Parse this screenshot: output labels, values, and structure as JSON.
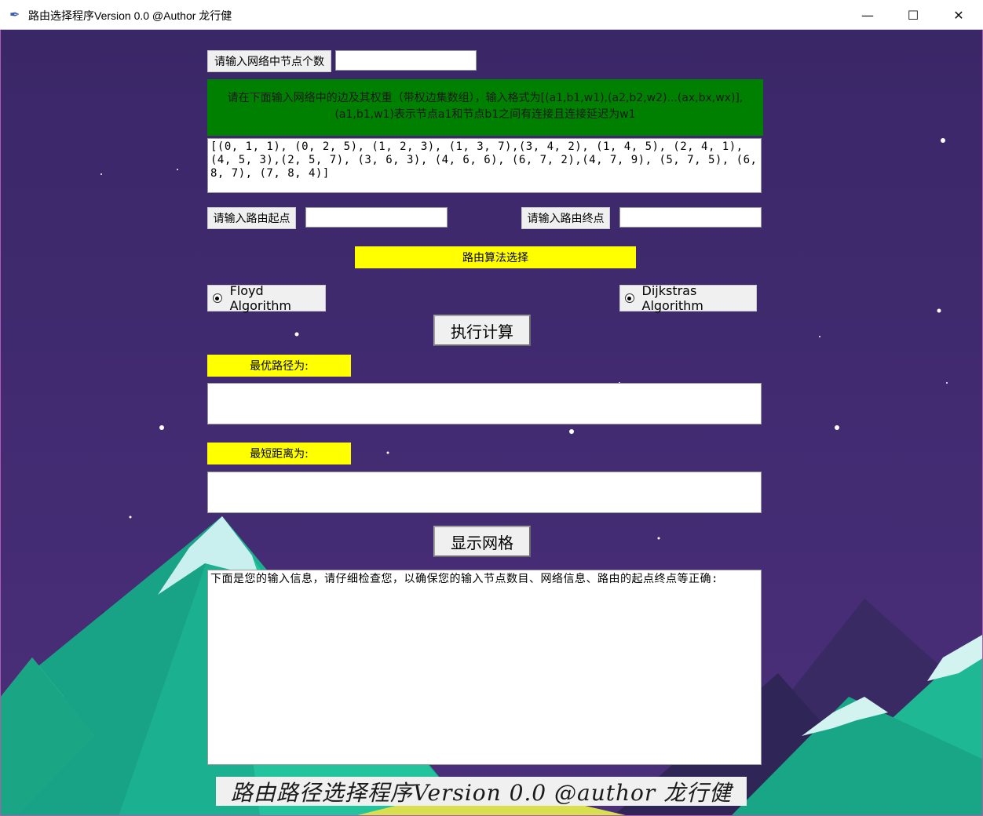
{
  "window": {
    "title": "路由选择程序Version 0.0 @Author 龙行健",
    "minimize": "—",
    "maximize": "☐",
    "close": "✕"
  },
  "form": {
    "node_count_label": "请输入网络中节点个数",
    "node_count_value": "",
    "edges_instruction": "请在下面输入网络中的边及其权重（带权边集数组），输入格式为[(a1,b1,w1),(a2,b2,w2)...(ax,bx,wx)],(a1,b1,w1)表示节点a1和节点b1之间有连接且连接延迟为w1",
    "edges_value": "[(0, 1, 1), (0, 2, 5), (1, 2, 3), (1, 3, 7),(3, 4, 2), (1, 4, 5), (2, 4, 1), (4, 5, 3),(2, 5, 7), (3, 6, 3), (4, 6, 6), (6, 7, 2),(4, 7, 9), (5, 7, 5), (6, 8, 7), (7, 8, 4)]",
    "start_label": "请输入路由起点",
    "start_value": "",
    "end_label": "请输入路由终点",
    "end_value": "",
    "algorithm_header": "路由算法选择",
    "floyd_label": "Floyd Algorithm",
    "dijkstra_label": "Dijkstras Algorithm",
    "compute_button": "执行计算",
    "best_path_label": "最优路径为:",
    "best_path_value": "",
    "shortest_distance_label": "最短距离为:",
    "shortest_distance_value": "",
    "show_grid_button": "显示网格",
    "info_text": "下面是您的输入信息，请仔细检查您，以确保您的输入节点数目、网络信息、路由的起点终点等正确:",
    "footer_text": "路由路径选择程序Version 0.0 @author 龙行健"
  },
  "colors": {
    "background": "#3b2a6b",
    "green_panel": "#008000",
    "yellow_label": "#ffff00",
    "mountain_teal": "#1fbf9a"
  }
}
